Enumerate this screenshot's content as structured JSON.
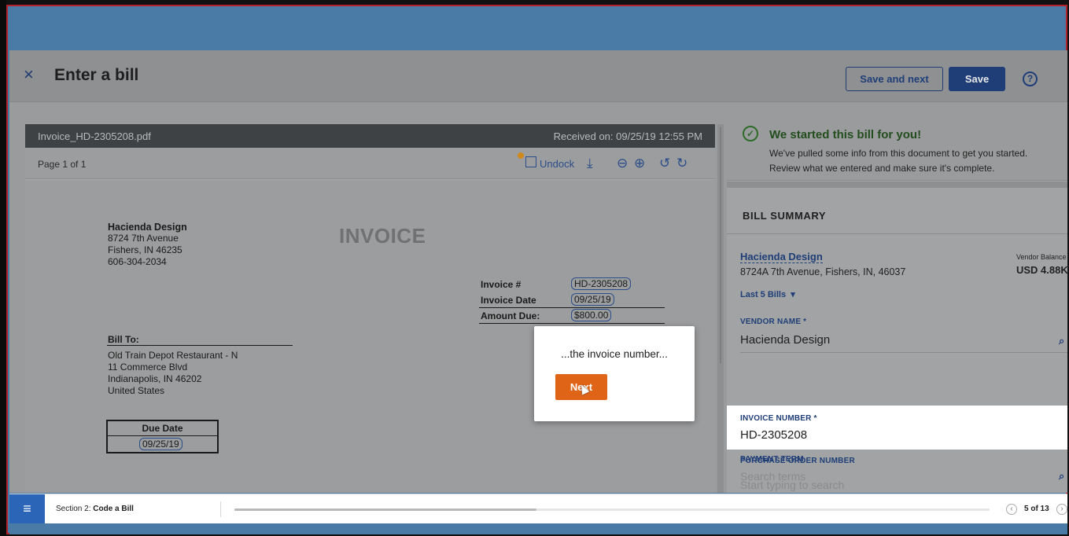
{
  "header": {
    "close_glyph": "×",
    "title": "Enter a bill",
    "save_and_next_label": "Save and next",
    "save_label": "Save",
    "help_glyph": "?"
  },
  "viewer": {
    "file_name": "Invoice_HD-2305208.pdf",
    "received": "Received on: 09/25/19 12:55 PM",
    "page_indicator": "Page 1 of 1",
    "undock_label": "Undock"
  },
  "invoice_doc": {
    "company_name": "Hacienda Design",
    "company_address": "8724 7th Avenue",
    "company_city": "Fishers, IN 46235",
    "company_phone": "606-304-2034",
    "heading": "INVOICE",
    "invoice_no_label": "Invoice #",
    "invoice_no": "HD-2305208",
    "invoice_date_label": "Invoice Date",
    "invoice_date": "09/25/19",
    "amount_due_label": "Amount Due:",
    "amount_due": "$800.00",
    "bill_to_label": "Bill To:",
    "bill_to_name": "Old Train Depot Restaurant - N",
    "bill_to_street": "11 Commerce Blvd",
    "bill_to_city": "Indianapolis, IN 46202",
    "bill_to_country": "United States",
    "due_date_label": "Due Date",
    "due_date": "09/25/19"
  },
  "banner": {
    "title": "We started this bill for you!",
    "line1": "We've pulled some info from this document to get you started.",
    "line2": "Review what we entered and make sure it's complete."
  },
  "bill_summary": {
    "heading": "BILL SUMMARY",
    "vendor_link": "Hacienda Design",
    "vendor_address": "8724A 7th Avenue, Fishers, IN, 46037",
    "vendor_balance_label": "Vendor Balance",
    "vendor_balance": "USD 4.88K",
    "last_bills_label": "Last 5 Bills",
    "fields": {
      "vendor_name_label": "VENDOR NAME *",
      "vendor_name_value": "Hacienda Design",
      "invoice_number_label": "INVOICE NUMBER *",
      "invoice_number_value": "HD-2305208",
      "po_number_label": "PURCHASE ORDER NUMBER",
      "po_number_placeholder": "Start typing to search",
      "payment_term_label": "PAYMENT TERM",
      "payment_term_placeholder": "Search terms"
    }
  },
  "popover": {
    "message": "...the invoice number...",
    "next_label": "Next"
  },
  "bottom_bar": {
    "section_prefix": "Section 2: ",
    "section_name": "Code a Bill",
    "progress_fraction": 0.4,
    "pager": "5 of 13"
  },
  "colors": {
    "accent_blue": "#1f3e78",
    "next_orange": "#e06417",
    "success_green": "#2f6b2a",
    "menu_blue": "#2a65b8"
  }
}
